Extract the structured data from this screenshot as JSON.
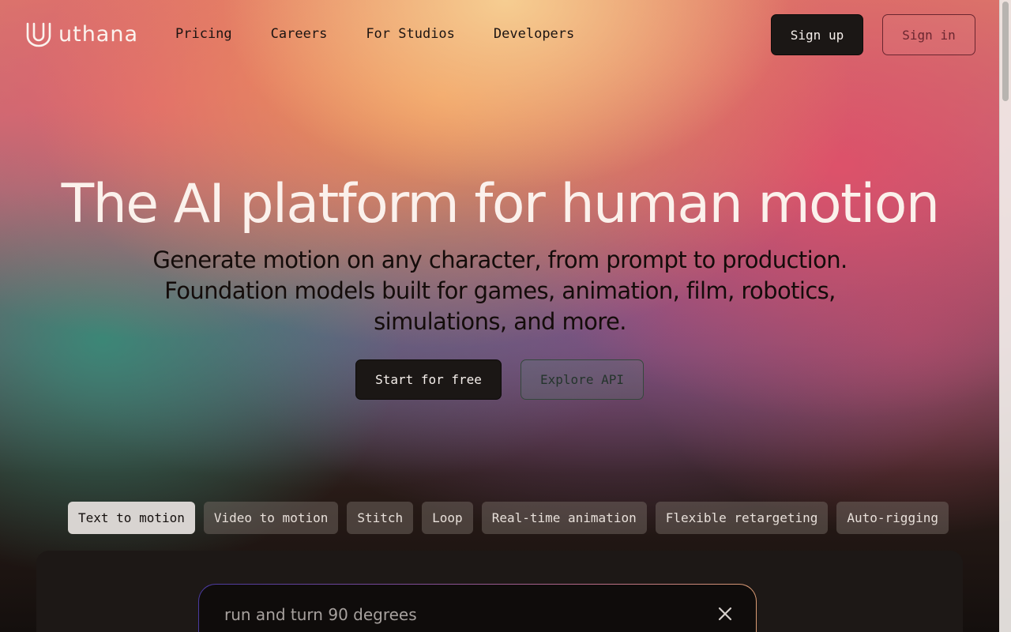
{
  "header": {
    "brand": "uthana",
    "nav_links": [
      {
        "label": "Pricing"
      },
      {
        "label": "Careers"
      },
      {
        "label": "For Studios"
      },
      {
        "label": "Developers"
      }
    ],
    "signup_label": "Sign up",
    "signin_label": "Sign in"
  },
  "hero": {
    "title": "The AI platform for human motion",
    "subtitle": "Generate motion on any character, from prompt to production. Foundation models built for games, animation, film, robotics, simulations, and more.",
    "primary_cta": "Start for free",
    "secondary_cta": "Explore API"
  },
  "feature_tabs": {
    "active_index": 0,
    "items": [
      {
        "label": "Text to motion"
      },
      {
        "label": "Video to motion"
      },
      {
        "label": "Stitch"
      },
      {
        "label": "Loop"
      },
      {
        "label": "Real-time animation"
      },
      {
        "label": "Flexible retargeting"
      },
      {
        "label": "Auto-rigging"
      }
    ]
  },
  "demo": {
    "prompt_value": "run and turn 90 degrees"
  },
  "icons": {
    "logo": "uthana-logo-icon",
    "clear": "close-icon"
  },
  "colors": {
    "primary_button": "#1b1715",
    "signin_border": "#6a2630",
    "active_tab": "#d8d4d1"
  }
}
